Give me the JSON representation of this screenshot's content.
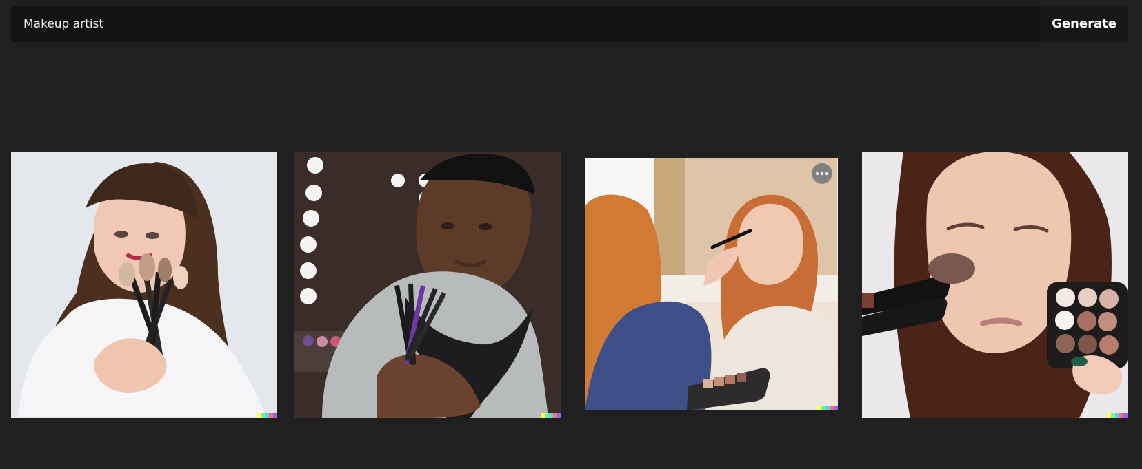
{
  "prompt": {
    "value": "Makeup artist"
  },
  "actions": {
    "generate_label": "Generate"
  },
  "gallery": {
    "items": [
      {
        "subject": "woman holding makeup brushes",
        "signature_colors": [
          "#ffff55",
          "#7cf77c",
          "#55d4ff",
          "#ff6f5a",
          "#8f65ff"
        ]
      },
      {
        "subject": "man holding makeup brushes in front of lit vanity mirror",
        "signature_colors": [
          "#ffff55",
          "#7cf77c",
          "#55d4ff",
          "#ff6f5a",
          "#8f65ff"
        ]
      },
      {
        "subject": "makeup artist applying eyeshadow to a woman",
        "signature_colors": [
          "#ffff55",
          "#7cf77c",
          "#55d4ff",
          "#ff6f5a",
          "#8f65ff"
        ]
      },
      {
        "subject": "woman having blush brushed on cheek with palette",
        "signature_colors": [
          "#ffff55",
          "#7cf77c",
          "#55d4ff",
          "#ff6f5a",
          "#8f65ff"
        ]
      }
    ]
  },
  "icons": {
    "more": "more-options-icon"
  },
  "theme": {
    "page_background": "#202020",
    "bar_background": "#131313",
    "text": "#ffffff"
  }
}
